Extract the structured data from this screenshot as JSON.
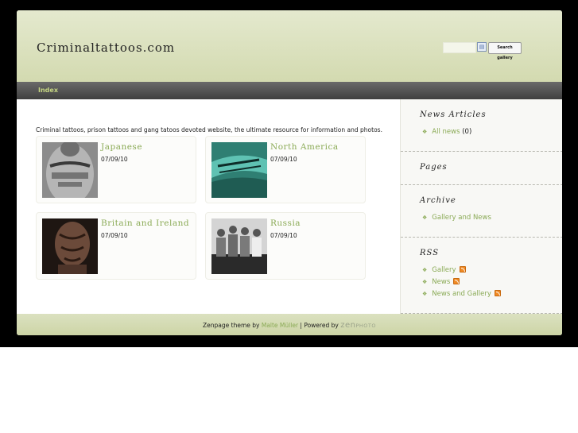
{
  "header": {
    "site_title": "Criminaltattoos.com",
    "search_placeholder": "",
    "search_button": "Search gallery"
  },
  "nav": {
    "index_label": "Index"
  },
  "main": {
    "intro": "Criminal tattoos, prison tattoos and gang tatoos devoted website, the ultimate resource for information and photos.",
    "albums": [
      {
        "title": "Japanese",
        "date": "07/09/10"
      },
      {
        "title": "North America",
        "date": "07/09/10"
      },
      {
        "title": "Britain and Ireland",
        "date": "07/09/10"
      },
      {
        "title": "Russia",
        "date": "07/09/10"
      }
    ]
  },
  "sidebar": {
    "news_articles": {
      "heading": "News Articles",
      "link": "All news",
      "count": "(0)"
    },
    "pages": {
      "heading": "Pages"
    },
    "archive": {
      "heading": "Archive",
      "link": "Gallery and News"
    },
    "rss": {
      "heading": "RSS",
      "items": [
        "Gallery",
        "News",
        "News and Gallery"
      ]
    }
  },
  "footer": {
    "prefix": "Zenpage theme by",
    "author": "Malte Müller",
    "separator": "| Powered by",
    "logo_zen": "zen",
    "logo_photo": "PHOTO"
  },
  "colors": {
    "accent_green": "#8aaa55",
    "header_bg": "#d3dab0",
    "nav_bg": "#4a4a4a",
    "rss_orange": "#f08a24"
  }
}
